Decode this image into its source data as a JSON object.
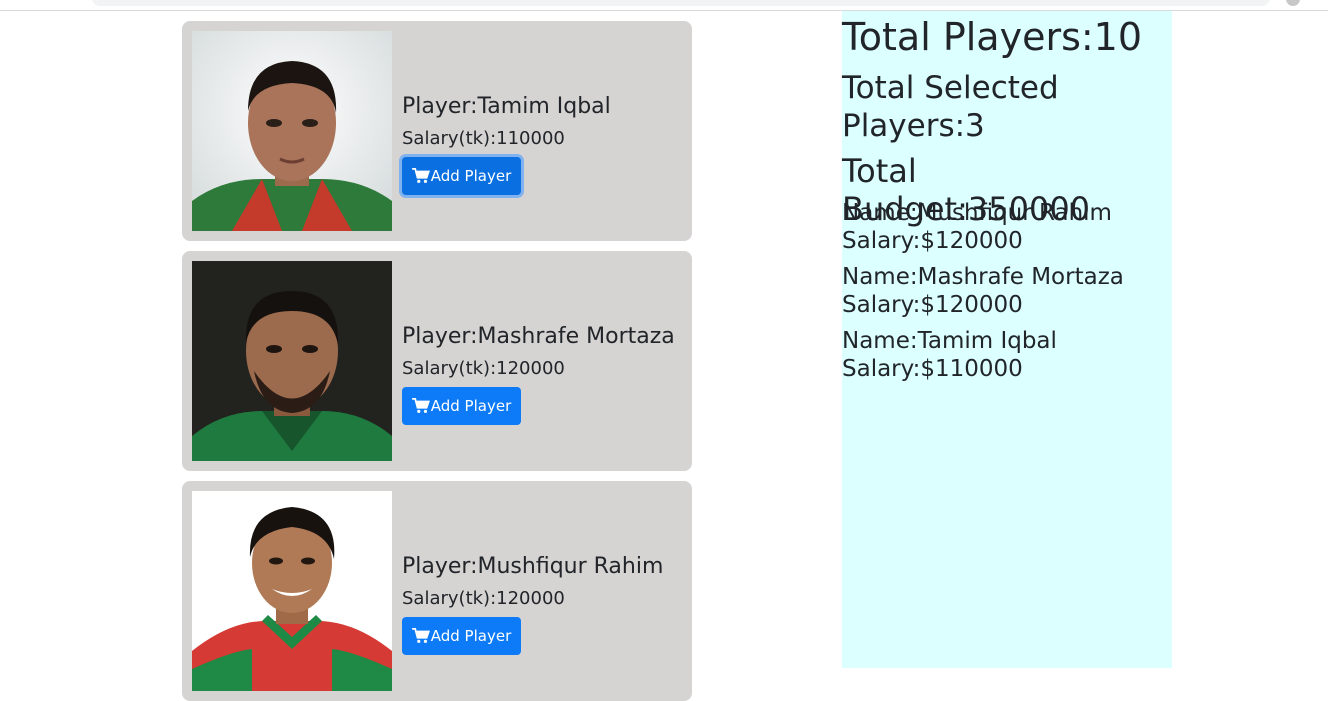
{
  "players": [
    {
      "label_prefix": "Player:",
      "name": "Tamim Iqbal",
      "salary_prefix": "Salary(tk):",
      "salary": "110000",
      "button_label": "Add Player"
    },
    {
      "label_prefix": "Player:",
      "name": "Mashrafe Mortaza",
      "salary_prefix": "Salary(tk):",
      "salary": "120000",
      "button_label": "Add Player"
    },
    {
      "label_prefix": "Player:",
      "name": "Mushfiqur Rahim",
      "salary_prefix": "Salary(tk):",
      "salary": "120000",
      "button_label": "Add Player"
    }
  ],
  "summary": {
    "total_players": "Total Players:10",
    "total_selected": "Total Selected Players:3",
    "total_budget": "Total Budget:350000",
    "selected": [
      {
        "name": "Name:Mushfiqur Rahim",
        "salary": "Salary:$120000"
      },
      {
        "name": "Name:Mashrafe Mortaza",
        "salary": "Salary:$120000"
      },
      {
        "name": "Name:Tamim Iqbal",
        "salary": "Salary:$110000"
      }
    ]
  },
  "colors": {
    "card_bg": "#d6d3d3",
    "button_bg": "#0d7bf7",
    "summary_bg": "#dcffff"
  },
  "icons": {
    "add_button_icon": "cart-icon"
  }
}
